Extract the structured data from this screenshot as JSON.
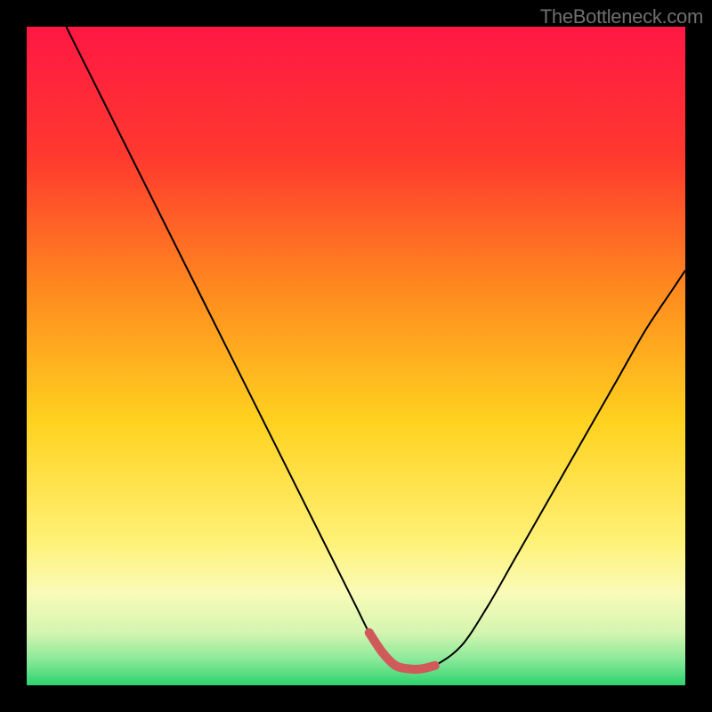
{
  "attribution": "TheBottleneck.com",
  "chart_data": {
    "type": "line",
    "title": "",
    "xlabel": "",
    "ylabel": "",
    "xlim": [
      0,
      100
    ],
    "ylim": [
      0,
      100
    ],
    "series": [
      {
        "name": "bottleneck-curve",
        "x": [
          6,
          10,
          14,
          18,
          22,
          26,
          30,
          34,
          38,
          42,
          46,
          50,
          52,
          54,
          56,
          58,
          60,
          62,
          66,
          70,
          74,
          78,
          82,
          86,
          90,
          94,
          98,
          100
        ],
        "values": [
          100,
          92,
          84,
          76,
          68,
          60,
          52,
          44,
          36,
          28,
          20,
          12,
          8,
          5,
          3,
          2.5,
          2.5,
          3,
          6,
          12,
          19,
          26,
          33,
          40,
          47,
          54,
          60,
          63
        ]
      }
    ],
    "optimal_zone": {
      "x_start": 52,
      "x_end": 62,
      "y": 3
    },
    "gradient_stops": [
      {
        "offset": 0,
        "color": "#ff1744"
      },
      {
        "offset": 20,
        "color": "#ff3a2e"
      },
      {
        "offset": 40,
        "color": "#ff8a1f"
      },
      {
        "offset": 60,
        "color": "#ffd21f"
      },
      {
        "offset": 78,
        "color": "#fff176"
      },
      {
        "offset": 86,
        "color": "#f9fbb8"
      },
      {
        "offset": 92,
        "color": "#d4f5b0"
      },
      {
        "offset": 96,
        "color": "#8ce99a"
      },
      {
        "offset": 100,
        "color": "#2dd36f"
      }
    ]
  }
}
